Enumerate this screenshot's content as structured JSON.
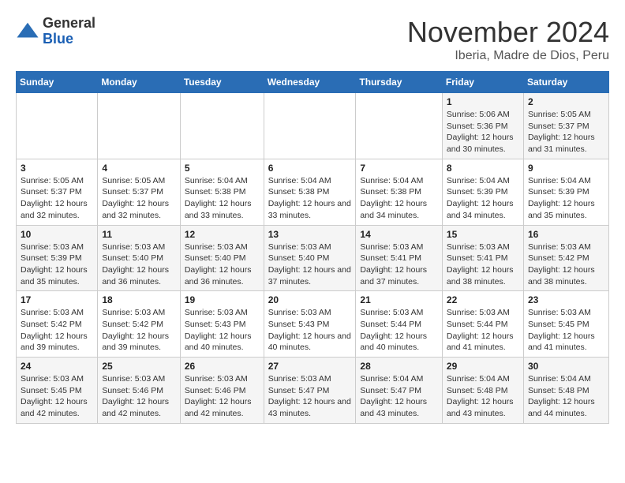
{
  "logo": {
    "general": "General",
    "blue": "Blue"
  },
  "title": "November 2024",
  "subtitle": "Iberia, Madre de Dios, Peru",
  "days_of_week": [
    "Sunday",
    "Monday",
    "Tuesday",
    "Wednesday",
    "Thursday",
    "Friday",
    "Saturday"
  ],
  "weeks": [
    [
      {
        "day": "",
        "info": ""
      },
      {
        "day": "",
        "info": ""
      },
      {
        "day": "",
        "info": ""
      },
      {
        "day": "",
        "info": ""
      },
      {
        "day": "",
        "info": ""
      },
      {
        "day": "1",
        "info": "Sunrise: 5:06 AM\nSunset: 5:36 PM\nDaylight: 12 hours and 30 minutes."
      },
      {
        "day": "2",
        "info": "Sunrise: 5:05 AM\nSunset: 5:37 PM\nDaylight: 12 hours and 31 minutes."
      }
    ],
    [
      {
        "day": "3",
        "info": "Sunrise: 5:05 AM\nSunset: 5:37 PM\nDaylight: 12 hours and 32 minutes."
      },
      {
        "day": "4",
        "info": "Sunrise: 5:05 AM\nSunset: 5:37 PM\nDaylight: 12 hours and 32 minutes."
      },
      {
        "day": "5",
        "info": "Sunrise: 5:04 AM\nSunset: 5:38 PM\nDaylight: 12 hours and 33 minutes."
      },
      {
        "day": "6",
        "info": "Sunrise: 5:04 AM\nSunset: 5:38 PM\nDaylight: 12 hours and 33 minutes."
      },
      {
        "day": "7",
        "info": "Sunrise: 5:04 AM\nSunset: 5:38 PM\nDaylight: 12 hours and 34 minutes."
      },
      {
        "day": "8",
        "info": "Sunrise: 5:04 AM\nSunset: 5:39 PM\nDaylight: 12 hours and 34 minutes."
      },
      {
        "day": "9",
        "info": "Sunrise: 5:04 AM\nSunset: 5:39 PM\nDaylight: 12 hours and 35 minutes."
      }
    ],
    [
      {
        "day": "10",
        "info": "Sunrise: 5:03 AM\nSunset: 5:39 PM\nDaylight: 12 hours and 35 minutes."
      },
      {
        "day": "11",
        "info": "Sunrise: 5:03 AM\nSunset: 5:40 PM\nDaylight: 12 hours and 36 minutes."
      },
      {
        "day": "12",
        "info": "Sunrise: 5:03 AM\nSunset: 5:40 PM\nDaylight: 12 hours and 36 minutes."
      },
      {
        "day": "13",
        "info": "Sunrise: 5:03 AM\nSunset: 5:40 PM\nDaylight: 12 hours and 37 minutes."
      },
      {
        "day": "14",
        "info": "Sunrise: 5:03 AM\nSunset: 5:41 PM\nDaylight: 12 hours and 37 minutes."
      },
      {
        "day": "15",
        "info": "Sunrise: 5:03 AM\nSunset: 5:41 PM\nDaylight: 12 hours and 38 minutes."
      },
      {
        "day": "16",
        "info": "Sunrise: 5:03 AM\nSunset: 5:42 PM\nDaylight: 12 hours and 38 minutes."
      }
    ],
    [
      {
        "day": "17",
        "info": "Sunrise: 5:03 AM\nSunset: 5:42 PM\nDaylight: 12 hours and 39 minutes."
      },
      {
        "day": "18",
        "info": "Sunrise: 5:03 AM\nSunset: 5:42 PM\nDaylight: 12 hours and 39 minutes."
      },
      {
        "day": "19",
        "info": "Sunrise: 5:03 AM\nSunset: 5:43 PM\nDaylight: 12 hours and 40 minutes."
      },
      {
        "day": "20",
        "info": "Sunrise: 5:03 AM\nSunset: 5:43 PM\nDaylight: 12 hours and 40 minutes."
      },
      {
        "day": "21",
        "info": "Sunrise: 5:03 AM\nSunset: 5:44 PM\nDaylight: 12 hours and 40 minutes."
      },
      {
        "day": "22",
        "info": "Sunrise: 5:03 AM\nSunset: 5:44 PM\nDaylight: 12 hours and 41 minutes."
      },
      {
        "day": "23",
        "info": "Sunrise: 5:03 AM\nSunset: 5:45 PM\nDaylight: 12 hours and 41 minutes."
      }
    ],
    [
      {
        "day": "24",
        "info": "Sunrise: 5:03 AM\nSunset: 5:45 PM\nDaylight: 12 hours and 42 minutes."
      },
      {
        "day": "25",
        "info": "Sunrise: 5:03 AM\nSunset: 5:46 PM\nDaylight: 12 hours and 42 minutes."
      },
      {
        "day": "26",
        "info": "Sunrise: 5:03 AM\nSunset: 5:46 PM\nDaylight: 12 hours and 42 minutes."
      },
      {
        "day": "27",
        "info": "Sunrise: 5:03 AM\nSunset: 5:47 PM\nDaylight: 12 hours and 43 minutes."
      },
      {
        "day": "28",
        "info": "Sunrise: 5:04 AM\nSunset: 5:47 PM\nDaylight: 12 hours and 43 minutes."
      },
      {
        "day": "29",
        "info": "Sunrise: 5:04 AM\nSunset: 5:48 PM\nDaylight: 12 hours and 43 minutes."
      },
      {
        "day": "30",
        "info": "Sunrise: 5:04 AM\nSunset: 5:48 PM\nDaylight: 12 hours and 44 minutes."
      }
    ]
  ],
  "colors": {
    "header_bg": "#2a6db5",
    "header_text": "#ffffff",
    "odd_row": "#f5f5f5",
    "even_row": "#ffffff"
  }
}
